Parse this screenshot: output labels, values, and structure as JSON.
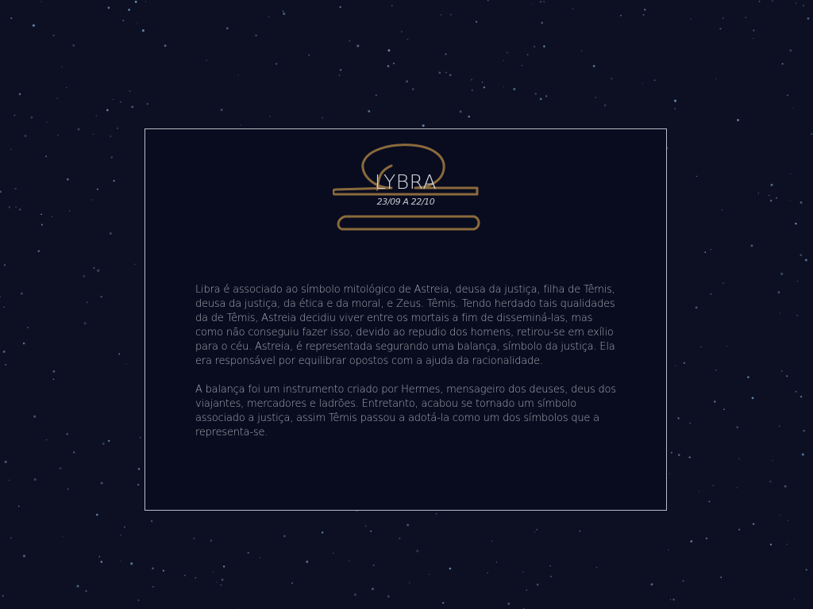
{
  "sign": {
    "icon": "libra-scale-icon",
    "title": "LYBRA",
    "dates": "23/09 A 22/10"
  },
  "description": {
    "paragraphs": [
      "Libra é associado ao símbolo mitológico de Astreia, deusa da justiça, filha de Têmis, deusa da justiça, da ética e da moral, e Zeus. Têmis. Tendo herdado tais qualidades da de Têmis, Astreia decidiu viver entre os mortais a fim de disseminá-las, mas como não conseguiu fazer isso, devido ao repudio dos homens, retirou-se em exílio para o céu. Astreia, é representada segurando uma balança, símbolo da justiça. Ela era responsável por equilibrar opostos com a ajuda da racionalidade.",
      "A balança foi um instrumento criado por Hermes, mensageiro dos deuses, deus dos viajantes, mercadores e ladrões. Entretanto, acabou se tornado um símbolo associado a justiça, assim Têmis passou a adotá-la como um dos símbolos que a representa-se."
    ]
  },
  "colors": {
    "background": "#0c1022",
    "card_background": "#090c1f",
    "card_border": "#b9bcc6",
    "icon_stroke": "#8a6a3c",
    "star": "#6b8bb3"
  }
}
